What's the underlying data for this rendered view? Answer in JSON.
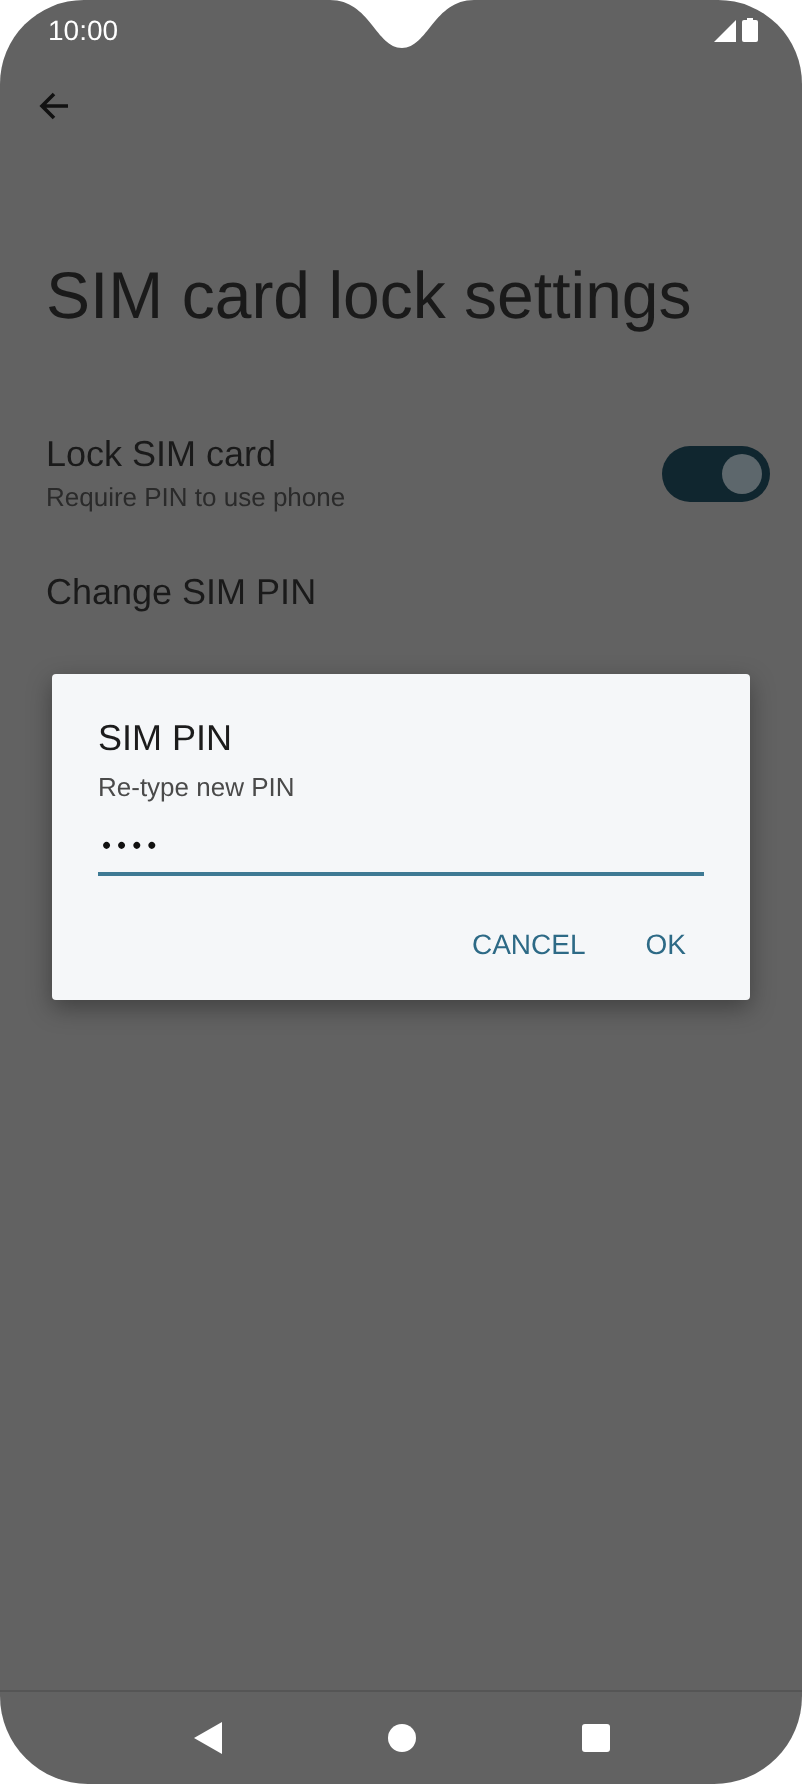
{
  "status_bar": {
    "time": "10:00"
  },
  "title": "SIM card lock settings",
  "preferences": [
    {
      "kind": "toggle",
      "title": "Lock SIM card",
      "summary": "Require PIN to use phone",
      "on": true
    },
    {
      "kind": "plain",
      "title": "Change SIM PIN"
    }
  ],
  "dialog": {
    "title": "SIM PIN",
    "message": "Re-type new PIN",
    "value": "••••",
    "buttons": [
      "CANCEL",
      "OK"
    ]
  }
}
